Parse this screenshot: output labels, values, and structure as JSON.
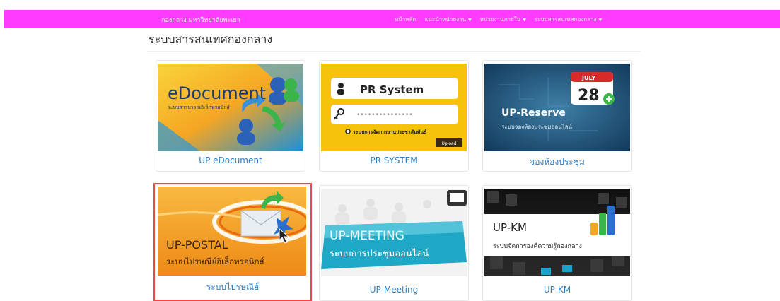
{
  "nav": {
    "brand": "กองกลาง มหาวิทยาลัยพะเยา",
    "items": [
      {
        "label": "หน้าหลัก",
        "dropdown": false
      },
      {
        "label": "แนะนำหน่วยงาน",
        "dropdown": true
      },
      {
        "label": "หน่วยงานภายใน",
        "dropdown": true
      },
      {
        "label": "ระบบสารสนเทศกองกลาง",
        "dropdown": true
      }
    ],
    "color": "#ff3cff"
  },
  "page": {
    "title": "ระบบสารสนเทศกองกลาง"
  },
  "cards": [
    {
      "label": "UP eDocument",
      "thumb": {
        "heading": "eDocument",
        "subtitle": "ระบบสารบรรณอิเล็กทรอนิกส์"
      }
    },
    {
      "label": "PR SYSTEM",
      "thumb": {
        "heading": "PR  System",
        "password_mask": "•••••••••••••••",
        "caption": "ระบบการจัดการงานประชาสัมพันธ์",
        "button": "Upload"
      }
    },
    {
      "label": "จองห้องประชุม",
      "thumb": {
        "month": "JULY",
        "day": "28",
        "heading": "UP-Reserve",
        "subtitle": "ระบบจองห้องประชุมออนไลน์"
      }
    },
    {
      "label": "ระบบไปรษณีย์",
      "selected": true,
      "thumb": {
        "heading": "UP-POSTAL",
        "subtitle": "ระบบไปรษณีย์อิเล็กทรอนิกส์"
      }
    },
    {
      "label": "UP-Meeting",
      "thumb": {
        "heading": "UP-MEETING",
        "subtitle": "ระบบการประชุมออนไลน์"
      }
    },
    {
      "label": "UP-KM",
      "thumb": {
        "heading": "UP-KM",
        "subtitle": "ระบบจัดการองค์ความรู้กองกลาง"
      }
    }
  ]
}
